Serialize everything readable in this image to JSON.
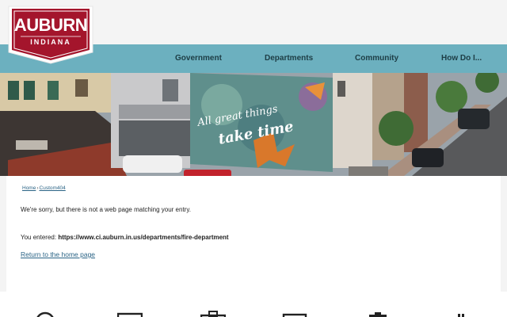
{
  "logo": {
    "main": "AUBURN",
    "sub": "INDIANA"
  },
  "nav": [
    "Government",
    "Departments",
    "Community",
    "How Do I..."
  ],
  "hero": {
    "mural_line1": "All great things",
    "mural_line2": "take time"
  },
  "breadcrumb": {
    "home": "Home",
    "separator": "›",
    "current": "Custom404"
  },
  "content": {
    "message": "We're sorry, but there is not a web page matching your entry.",
    "entered_label": "You entered:",
    "entered_url": "https://www.ci.auburn.in.us/departments/fire-department",
    "home_link": "Return to the home page"
  },
  "bottom_icons": [
    "clock-icon",
    "monitor-icon",
    "briefcase-icon",
    "laptop-icon",
    "trash-can-icon",
    "pin-icon"
  ],
  "colors": {
    "nav_bg": "#6cb0bf",
    "logo_red": "#a4152c",
    "link": "#2b6486"
  }
}
